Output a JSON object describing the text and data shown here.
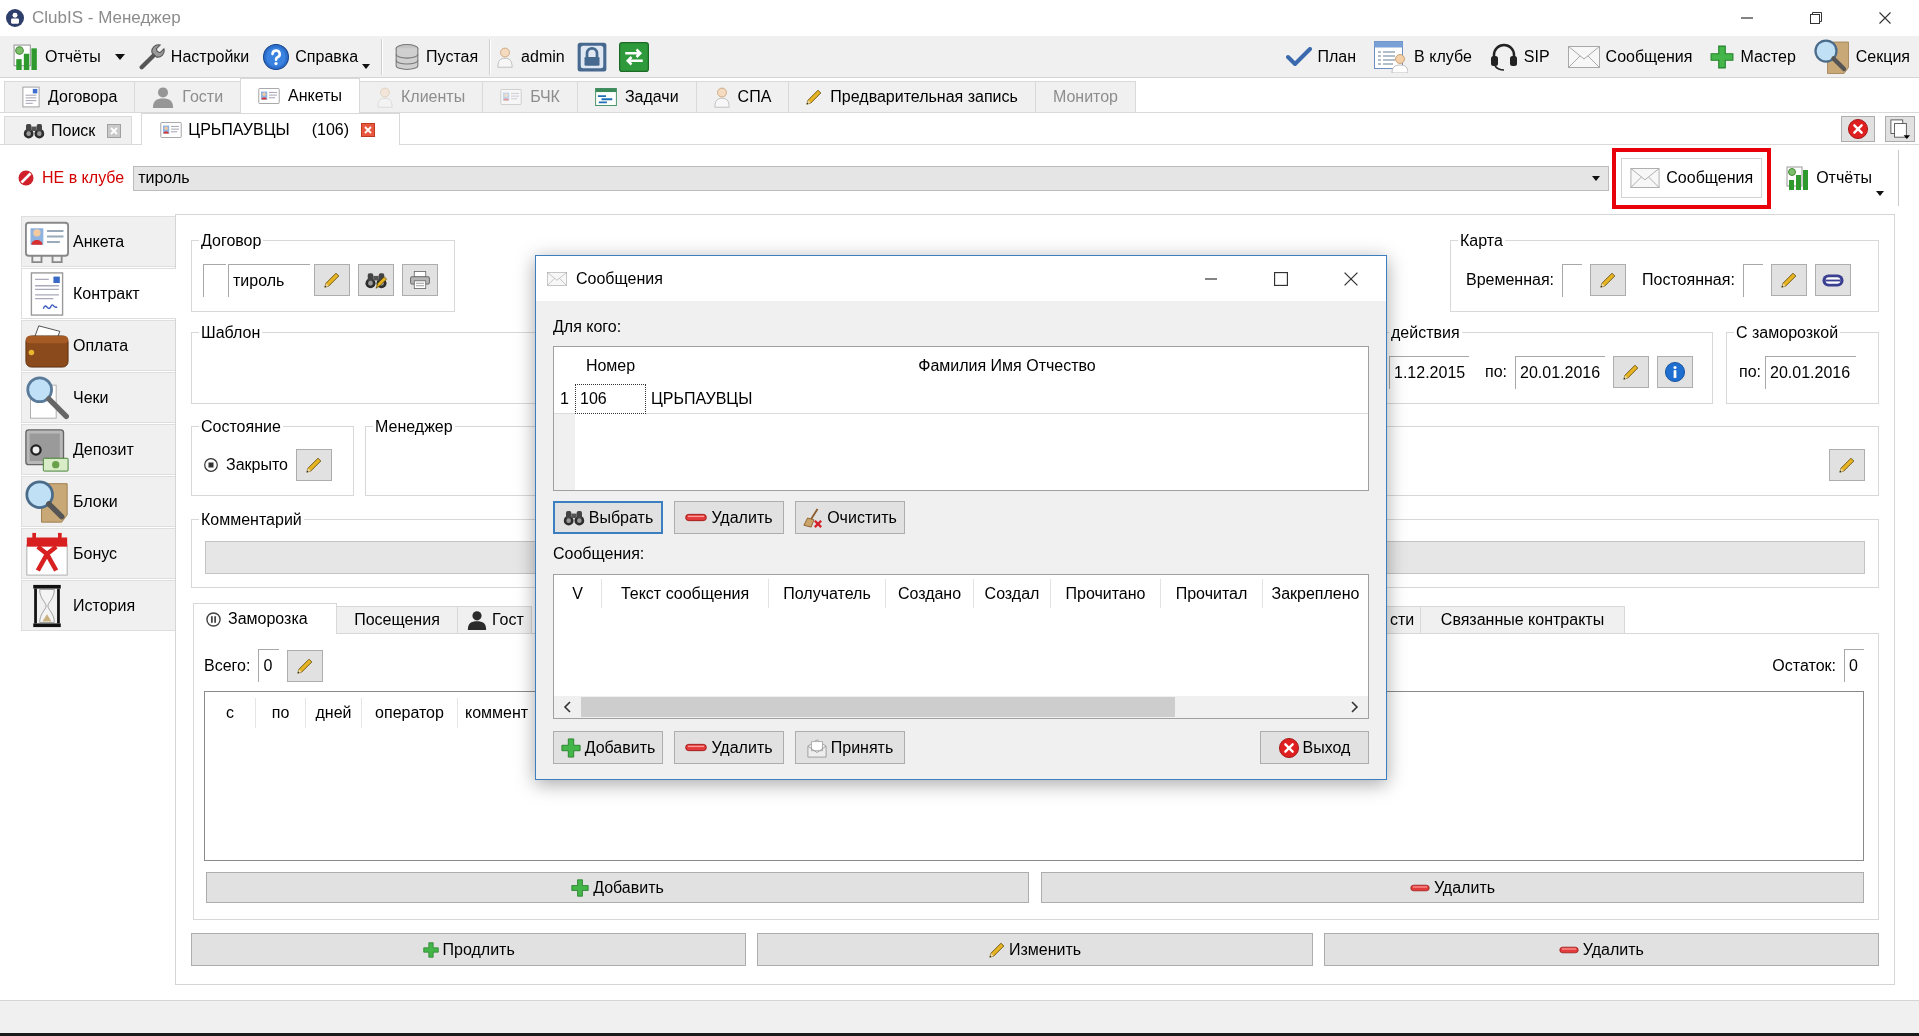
{
  "window": {
    "title": "ClubIS - Менеджер"
  },
  "toolbar": {
    "left_groups": [
      [
        {
          "label": "Отчёты",
          "kind": "split"
        },
        {
          "label": "Настройки",
          "kind": "button"
        },
        {
          "label": "Справка",
          "kind": "menu"
        }
      ],
      [
        {
          "label": "Пустая",
          "kind": "button"
        }
      ],
      [
        {
          "label": "admin",
          "kind": "user"
        }
      ]
    ],
    "right": [
      {
        "label": "План"
      },
      {
        "label": "В клубе"
      },
      {
        "label": "SIP"
      },
      {
        "label": "Сообщения"
      },
      {
        "label": "Мастер"
      },
      {
        "label": "Секция"
      }
    ]
  },
  "main_tabs": [
    {
      "label": "Договора",
      "selected": false,
      "disabled": false
    },
    {
      "label": "Гости",
      "selected": false,
      "disabled": true
    },
    {
      "label": "Анкеты",
      "selected": true,
      "disabled": false
    },
    {
      "label": "Клиенты",
      "selected": false,
      "disabled": true
    },
    {
      "label": "БЧК",
      "selected": false,
      "disabled": true
    },
    {
      "label": "Задачи",
      "selected": false,
      "disabled": false
    },
    {
      "label": "СПА",
      "selected": false,
      "disabled": false
    },
    {
      "label": "Предварительная запись",
      "selected": false,
      "disabled": false
    },
    {
      "label": "Монитор",
      "selected": false,
      "disabled": true
    }
  ],
  "doc_tabs": [
    {
      "label": "Поиск",
      "selected": false
    },
    {
      "label": "ЦРЬПАУВЦЫ",
      "count": "(106)",
      "selected": true
    }
  ],
  "client_bar": {
    "status": "НЕ в клубе",
    "contract": "тироль",
    "buttons": [
      {
        "label": "Сообщения",
        "highlighted": true
      },
      {
        "label": "Отчёты",
        "highlighted": false
      }
    ]
  },
  "sidebar": {
    "items": [
      {
        "label": "Анкета",
        "selected": false
      },
      {
        "label": "Контракт",
        "selected": true
      },
      {
        "label": "Оплата",
        "selected": false
      },
      {
        "label": "Чеки",
        "selected": false
      },
      {
        "label": "Депозит",
        "selected": false
      },
      {
        "label": "Блоки",
        "selected": false
      },
      {
        "label": "Бонус",
        "selected": false
      },
      {
        "label": "История",
        "selected": false
      }
    ]
  },
  "contract_form": {
    "contract": {
      "title": "Договор",
      "value": "тироль"
    },
    "card": {
      "title": "Карта",
      "temporary_label": "Временная:",
      "permanent_label": "Постоянная:"
    },
    "template": {
      "title": "Шаблон"
    },
    "validity": {
      "title": "действия",
      "from": "1.12.2015",
      "to_label": "по:",
      "to": "20.01.2016"
    },
    "with_freeze": {
      "title": "С заморозкой",
      "to_label": "по:",
      "to": "20.01.2016"
    },
    "state": {
      "title": "Состояние",
      "label": "Закрыто",
      "checked": true
    },
    "manager": {
      "title": "Менеджер"
    },
    "comment": {
      "title": "Комментарий"
    },
    "tabs": [
      {
        "label": "Заморозка",
        "selected": true
      },
      {
        "label": "Посещения",
        "selected": false
      },
      {
        "label": "Гост",
        "selected": false
      },
      {
        "label": "сти",
        "selected": false
      },
      {
        "label": "Связанные контракты",
        "selected": false
      }
    ],
    "freeze": {
      "total_label": "Всего:",
      "total": "0",
      "remaining_label": "Остаток:",
      "remaining": "0",
      "columns": [
        "с",
        "по",
        "дней",
        "оператор",
        "коммент"
      ],
      "buttons": [
        "Добавить",
        "Удалить"
      ]
    },
    "actions": [
      "Продлить",
      "Изменить",
      "Удалить"
    ]
  },
  "dialog": {
    "title": "Сообщения",
    "recipients_label": "Для кого:",
    "recipients": {
      "columns": [
        "Номер",
        "Фамилия Имя Отчество"
      ],
      "rows": [
        {
          "index": "1",
          "number": "106",
          "name": "ЦРЬПАУВЦЫ",
          "focused": true
        }
      ]
    },
    "recipient_buttons": [
      {
        "label": "Выбрать",
        "focused": true
      },
      {
        "label": "Удалить",
        "focused": false
      },
      {
        "label": "Очистить",
        "focused": false
      }
    ],
    "messages_label": "Сообщения:",
    "messages": {
      "columns": [
        "V",
        "Текст сообщения",
        "Получатель",
        "Создано",
        "Создал",
        "Прочитано",
        "Прочитал",
        "Закреплено"
      ]
    },
    "buttons": [
      "Добавить",
      "Удалить",
      "Принять"
    ],
    "exit_button": "Выход"
  }
}
